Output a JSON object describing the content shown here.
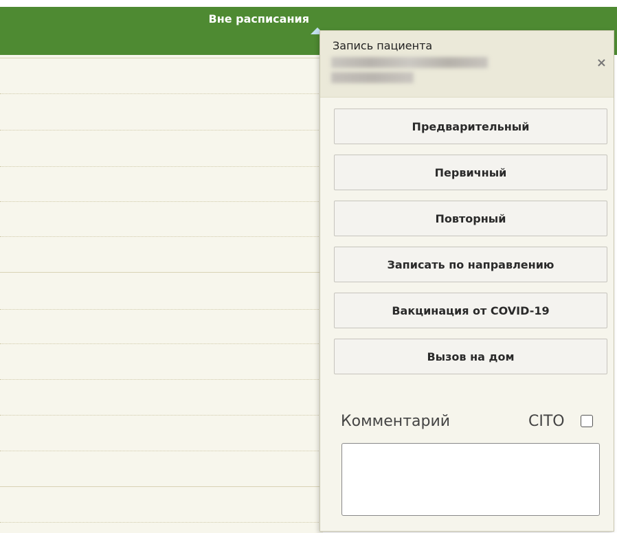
{
  "header": {
    "title": "Вне расписания"
  },
  "popup": {
    "title": "Запись пациента",
    "close_symbol": "×",
    "buttons": [
      {
        "label": "Предварительный"
      },
      {
        "label": "Первичный"
      },
      {
        "label": "Повторный"
      },
      {
        "label": "Записать по направлению"
      },
      {
        "label": "Вакцинация от COVID-19"
      },
      {
        "label": "Вызов на дом"
      }
    ],
    "comment_label": "Комментарий",
    "cito_label": "CITO",
    "cito_checked": false,
    "comment_value": ""
  },
  "colors": {
    "header_green": "#4e8a32",
    "panel_bg": "#f6f5ec",
    "button_bg": "#f4f3ef"
  },
  "icons": {
    "close": "close-icon",
    "checkbox": "checkbox-icon"
  }
}
